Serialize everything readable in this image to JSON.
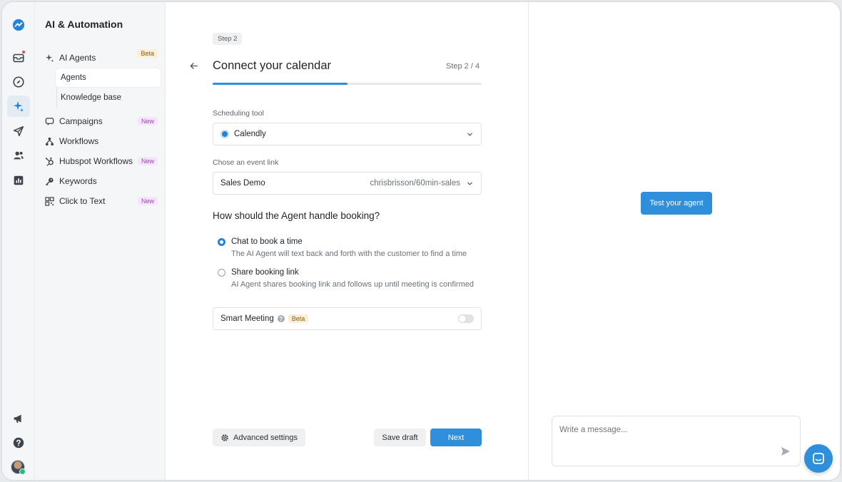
{
  "sidebar": {
    "title": "AI & Automation",
    "items": [
      {
        "label": "AI Agents",
        "badge": "Beta"
      },
      {
        "label": "Campaigns",
        "badge": "New"
      },
      {
        "label": "Workflows",
        "badge": ""
      },
      {
        "label": "Hubspot Workflows",
        "badge": "New"
      },
      {
        "label": "Keywords",
        "badge": ""
      },
      {
        "label": "Click to Text",
        "badge": "New"
      }
    ],
    "sub_items": [
      {
        "label": "Agents",
        "active": true
      },
      {
        "label": "Knowledge base",
        "active": false
      }
    ]
  },
  "main": {
    "step_pill": "Step 2",
    "title": "Connect your calendar",
    "step_count": "Step 2 / 4",
    "progress_fraction": 0.5,
    "scheduling_label": "Scheduling tool",
    "scheduling_value": "Calendly",
    "event_label": "Chose an event link",
    "event_value": "Sales Demo",
    "event_slug": "chrisbrisson/60min-sales",
    "booking_heading": "How should the Agent handle booking?",
    "options": [
      {
        "title": "Chat to book a time",
        "desc": "The AI Agent will text back and forth with the customer to find a time",
        "selected": true
      },
      {
        "title": "Share booking link",
        "desc": "AI Agent shares booking link and follows up until meeting is confirmed",
        "selected": false
      }
    ],
    "smart_meeting": {
      "label": "Smart Meeting",
      "badge": "Beta",
      "enabled": false
    },
    "buttons": {
      "advanced": "Advanced settings",
      "save_draft": "Save draft",
      "next": "Next"
    }
  },
  "preview": {
    "test_button": "Test your agent",
    "message_placeholder": "Write a message..."
  },
  "colors": {
    "accent": "#2f8fdb",
    "beta_bg": "#fcefd9",
    "new_fg": "#a240c9"
  }
}
